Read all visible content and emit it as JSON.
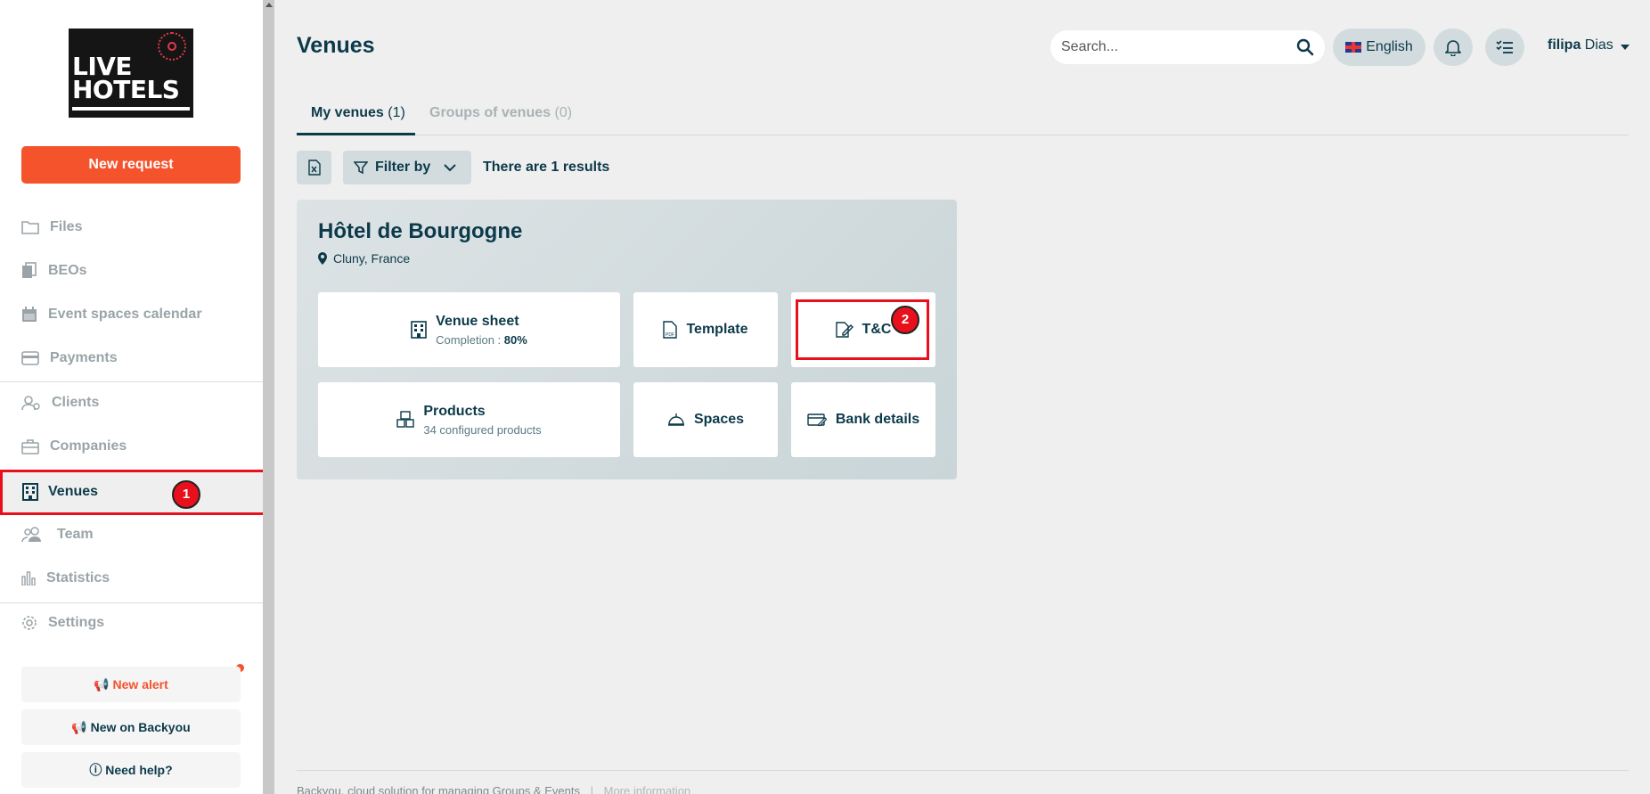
{
  "sidebar": {
    "logo_text_line1": "LIVE",
    "logo_text_line2": "HOTELS",
    "new_request_label": "New request",
    "nav": {
      "files": "Files",
      "beos": "BEOs",
      "event_spaces_calendar": "Event spaces calendar",
      "payments": "Payments",
      "clients": "Clients",
      "companies": "Companies",
      "venues": "Venues",
      "team": "Team",
      "statistics": "Statistics",
      "settings": "Settings"
    },
    "new_alert_label": "New alert",
    "new_on_backyou_label": "New on Backyou",
    "need_help_label": "Need help?"
  },
  "header": {
    "title": "Venues",
    "search_placeholder": "Search...",
    "language": "English",
    "user_first": "filipa",
    "user_last": "Dias"
  },
  "tabs": {
    "my_venues_label": "My venues",
    "my_venues_count": "(1)",
    "groups_label": "Groups of venues",
    "groups_count": "(0)"
  },
  "toolbar": {
    "filter_label": "Filter by",
    "results_text": "There are 1 results"
  },
  "venue": {
    "name": "Hôtel de Bourgogne",
    "location": "Cluny, France",
    "tiles": {
      "venue_sheet": "Venue sheet",
      "completion_label": "Completion :",
      "completion_value": "80%",
      "template": "Template",
      "tc": "T&C",
      "products": "Products",
      "products_sub": "34 configured products",
      "spaces": "Spaces",
      "bank_details": "Bank details"
    }
  },
  "annotations": {
    "badge1": "1",
    "badge2": "2"
  },
  "footer": {
    "text": "Backyou, cloud solution for managing Groups & Events",
    "separator": "|",
    "more": "More information"
  },
  "colors": {
    "accent_orange": "#f4532c",
    "dark_teal": "#0c3a4a",
    "highlight_red": "#e8101c"
  }
}
